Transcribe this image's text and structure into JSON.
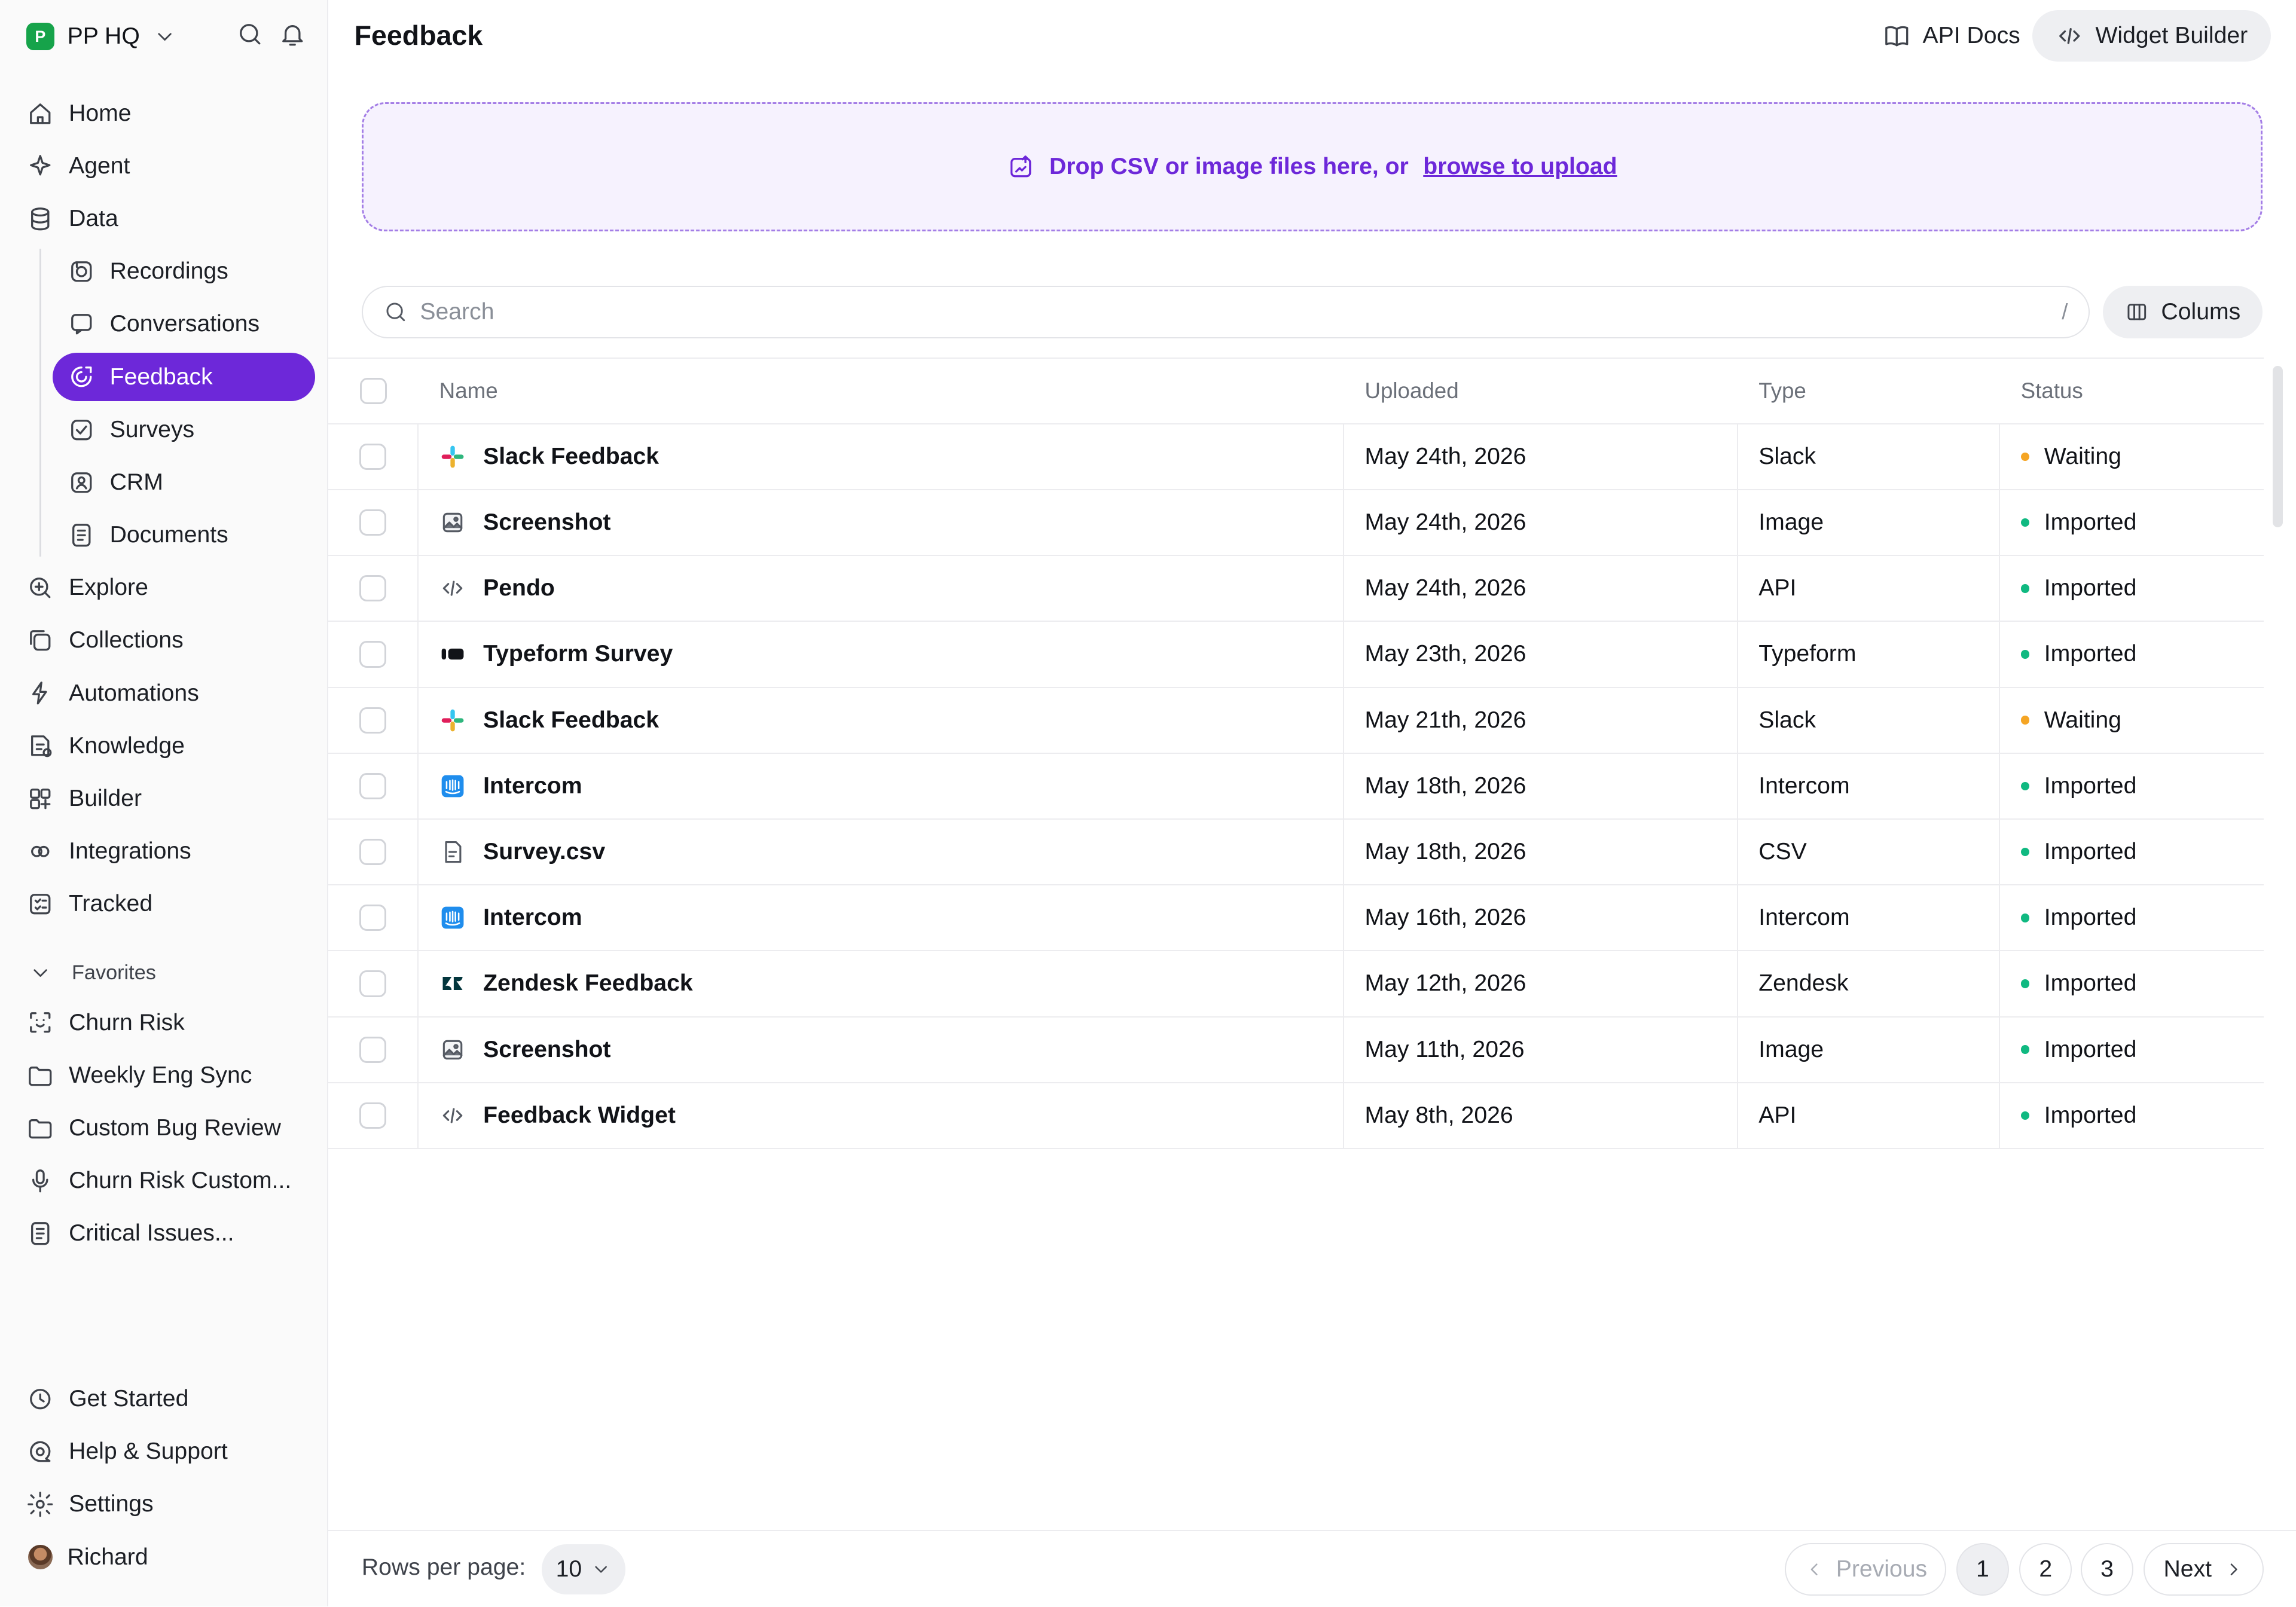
{
  "workspace": {
    "name": "PP HQ",
    "logo_letter": "P"
  },
  "sidebar": {
    "main_items": [
      {
        "label": "Home",
        "icon": "home-icon"
      },
      {
        "label": "Agent",
        "icon": "sparkle-icon"
      },
      {
        "label": "Data",
        "icon": "database-icon"
      }
    ],
    "data_sub_items": [
      {
        "label": "Recordings",
        "icon": "recordings-icon"
      },
      {
        "label": "Conversations",
        "icon": "chat-icon"
      },
      {
        "label": "Feedback",
        "icon": "feedback-icon",
        "active": true
      },
      {
        "label": "Surveys",
        "icon": "survey-icon"
      },
      {
        "label": "CRM",
        "icon": "contact-icon"
      },
      {
        "label": "Documents",
        "icon": "document-icon"
      }
    ],
    "more_items": [
      {
        "label": "Explore",
        "icon": "zoom-icon"
      },
      {
        "label": "Collections",
        "icon": "collections-icon"
      },
      {
        "label": "Automations",
        "icon": "automation-icon"
      },
      {
        "label": "Knowledge",
        "icon": "knowledge-icon"
      },
      {
        "label": "Builder",
        "icon": "builder-icon"
      },
      {
        "label": "Integrations",
        "icon": "integrations-icon"
      },
      {
        "label": "Tracked",
        "icon": "tracked-icon"
      }
    ],
    "favorites_label": "Favorites",
    "favorites": [
      {
        "label": "Churn Risk",
        "icon": "scan-icon"
      },
      {
        "label": "Weekly Eng Sync",
        "icon": "folder-icon"
      },
      {
        "label": "Custom Bug Review",
        "icon": "folder-icon"
      },
      {
        "label": "Churn Risk Custom...",
        "icon": "microphone-icon"
      },
      {
        "label": "Critical Issues...",
        "icon": "document-icon"
      }
    ],
    "bottom_items": [
      {
        "label": "Get Started",
        "icon": "clock-icon"
      },
      {
        "label": "Help & Support",
        "icon": "help-icon"
      },
      {
        "label": "Settings",
        "icon": "gear-icon"
      }
    ],
    "user": {
      "name": "Richard"
    }
  },
  "header": {
    "title": "Feedback",
    "api_docs_label": "API Docs",
    "widget_builder_label": "Widget Builder"
  },
  "dropzone": {
    "text": "Drop CSV or image files here, or",
    "link": "browse to upload"
  },
  "search": {
    "placeholder": "Search",
    "shortcut": "/"
  },
  "columns_button": "Colums",
  "table": {
    "headers": {
      "name": "Name",
      "uploaded": "Uploaded",
      "type": "Type",
      "status": "Status"
    },
    "rows": [
      {
        "name": "Slack Feedback",
        "uploaded": "May 24th, 2026",
        "type": "Slack",
        "status": "Waiting",
        "icon": "slack-icon"
      },
      {
        "name": "Screenshot",
        "uploaded": "May 24th, 2026",
        "type": "Image",
        "status": "Imported",
        "icon": "image-icon"
      },
      {
        "name": "Pendo",
        "uploaded": "May 24th, 2026",
        "type": "API",
        "status": "Imported",
        "icon": "code-icon"
      },
      {
        "name": "Typeform Survey",
        "uploaded": "May 23th, 2026",
        "type": "Typeform",
        "status": "Imported",
        "icon": "typeform-icon"
      },
      {
        "name": "Slack Feedback",
        "uploaded": "May 21th, 2026",
        "type": "Slack",
        "status": "Waiting",
        "icon": "slack-icon"
      },
      {
        "name": "Intercom",
        "uploaded": "May 18th, 2026",
        "type": "Intercom",
        "status": "Imported",
        "icon": "intercom-icon"
      },
      {
        "name": "Survey.csv",
        "uploaded": "May 18th, 2026",
        "type": "CSV",
        "status": "Imported",
        "icon": "csv-file-icon"
      },
      {
        "name": "Intercom",
        "uploaded": "May 16th, 2026",
        "type": "Intercom",
        "status": "Imported",
        "icon": "intercom-icon"
      },
      {
        "name": "Zendesk Feedback",
        "uploaded": "May 12th, 2026",
        "type": "Zendesk",
        "status": "Imported",
        "icon": "zendesk-icon"
      },
      {
        "name": "Screenshot",
        "uploaded": "May 11th, 2026",
        "type": "Image",
        "status": "Imported",
        "icon": "image-icon"
      },
      {
        "name": "Feedback Widget",
        "uploaded": "May 8th, 2026",
        "type": "API",
        "status": "Imported",
        "icon": "code-icon"
      }
    ]
  },
  "status_colors": {
    "Waiting": "#f5a524",
    "Imported": "#10b981"
  },
  "pagination": {
    "rows_per_page_label": "Rows per page:",
    "rows_per_page": "10",
    "previous": "Previous",
    "pages": [
      "1",
      "2",
      "3"
    ],
    "current_page": "1",
    "next": "Next"
  },
  "colors": {
    "accent": "#6d28d9",
    "dropzone_bg": "#f6f2fe"
  }
}
